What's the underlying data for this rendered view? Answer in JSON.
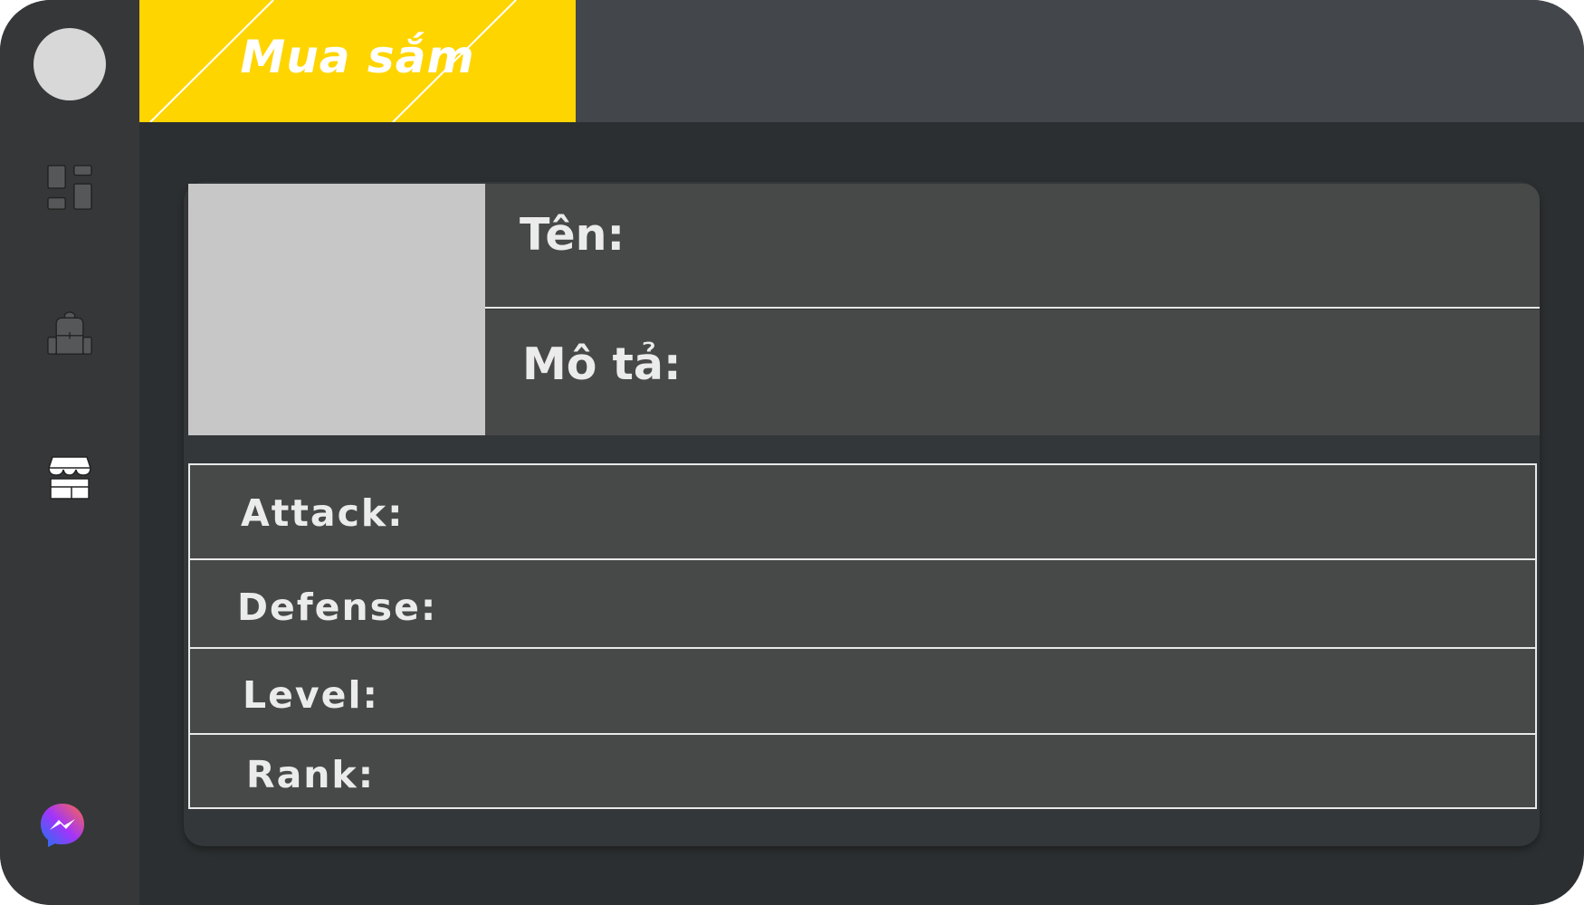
{
  "header": {
    "tab_title": "Mua sắm",
    "accent_color": "#ffd500"
  },
  "sidebar": {
    "items": [
      {
        "icon": "avatar"
      },
      {
        "icon": "dashboard-icon"
      },
      {
        "icon": "backpack-icon"
      },
      {
        "icon": "shop-icon",
        "active": true
      },
      {
        "icon": "messenger-icon"
      }
    ]
  },
  "item": {
    "name_label": "Tên:",
    "description_label": "Mô tả:"
  },
  "stats": {
    "attack_label": "Attack:",
    "defense_label": "Defense:",
    "level_label": "Level:",
    "rank_label": "Rank:"
  }
}
